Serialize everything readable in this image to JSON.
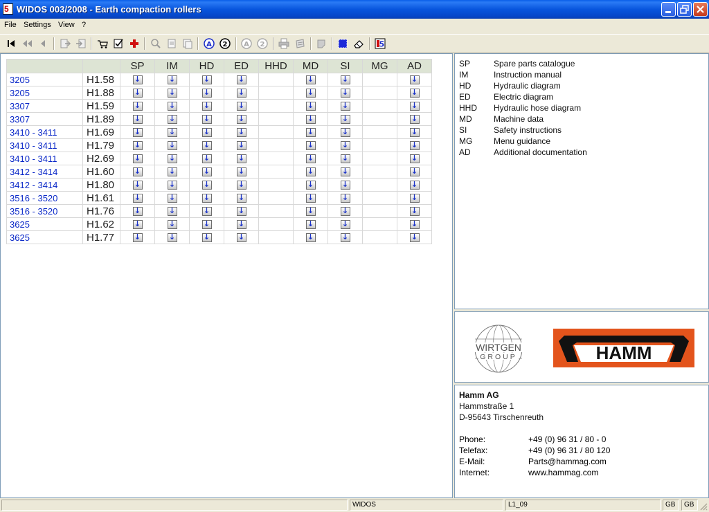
{
  "window": {
    "title": "WIDOS 003/2008 - Earth compaction rollers",
    "icon_name": "widos-app-icon"
  },
  "menu": [
    "File",
    "Settings",
    "View",
    "?"
  ],
  "toolbar": {
    "icons": [
      "first-record-icon",
      "previous-fast-icon",
      "previous-icon",
      "export-icon",
      "import-icon",
      "cart-icon",
      "checklist-icon",
      "add-red-cross-icon",
      "zoom-icon",
      "page-icon",
      "page-copy-icon",
      "marker-a-icon",
      "marker-2-icon",
      "marker-a-disabled-icon",
      "marker-2-disabled-icon",
      "print-icon",
      "print-preview-icon",
      "note-icon",
      "select-grid-icon",
      "eraser-icon",
      "widos-logo-icon"
    ]
  },
  "table": {
    "columns": [
      "",
      "",
      "SP",
      "IM",
      "HD",
      "ED",
      "HHD",
      "MD",
      "SI",
      "MG",
      "AD"
    ],
    "doc_columns": [
      "SP",
      "IM",
      "HD",
      "ED",
      "HHD",
      "MD",
      "SI",
      "MG",
      "AD"
    ],
    "available": [
      "SP",
      "IM",
      "HD",
      "ED",
      "MD",
      "SI",
      "AD"
    ],
    "rows": [
      {
        "model": "3205",
        "version": "H1.58"
      },
      {
        "model": "3205",
        "version": "H1.88"
      },
      {
        "model": "3307",
        "version": "H1.59"
      },
      {
        "model": "3307",
        "version": "H1.89"
      },
      {
        "model": "3410 - 3411",
        "version": "H1.69"
      },
      {
        "model": "3410 - 3411",
        "version": "H1.79"
      },
      {
        "model": "3410 - 3411",
        "version": "H2.69"
      },
      {
        "model": "3412 - 3414",
        "version": "H1.60"
      },
      {
        "model": "3412 - 3414",
        "version": "H1.80"
      },
      {
        "model": "3516 - 3520",
        "version": "H1.61"
      },
      {
        "model": "3516 - 3520",
        "version": "H1.76"
      },
      {
        "model": "3625",
        "version": "H1.62"
      },
      {
        "model": "3625",
        "version": "H1.77"
      }
    ],
    "download_icon": "download-arrow-icon"
  },
  "legend": [
    {
      "abbr": "SP",
      "desc": "Spare parts catalogue"
    },
    {
      "abbr": "IM",
      "desc": "Instruction manual"
    },
    {
      "abbr": "HD",
      "desc": "Hydraulic diagram"
    },
    {
      "abbr": "ED",
      "desc": "Electric diagram"
    },
    {
      "abbr": "HHD",
      "desc": "Hydraulic hose diagram"
    },
    {
      "abbr": "MD",
      "desc": "Machine data"
    },
    {
      "abbr": "SI",
      "desc": "Safety instructions"
    },
    {
      "abbr": "MG",
      "desc": "Menu guidance"
    },
    {
      "abbr": "AD",
      "desc": "Additional documentation"
    }
  ],
  "logos": {
    "wirtgen": {
      "line1": "WIRTGEN",
      "line2": "GROUP"
    },
    "hamm": {
      "text": "HAMM",
      "background": "#e3541c"
    }
  },
  "address": {
    "company": "Hamm AG",
    "street": "Hammstraße 1",
    "city": "D-95643 Tirschenreuth",
    "contacts": [
      {
        "label": "Phone:",
        "value": "+49 (0) 96 31 / 80 - 0"
      },
      {
        "label": "Telefax:",
        "value": "+49 (0) 96 31 / 80 120"
      },
      {
        "label": "E-Mail:",
        "value": "Parts@hammag.com"
      },
      {
        "label": "Internet:",
        "value": "www.hammag.com"
      }
    ]
  },
  "status": {
    "app": "WIDOS",
    "code": "L1_09",
    "lang1": "GB",
    "lang2": "GB"
  },
  "colors": {
    "link": "#0a28c8",
    "header_bg": "#dde4d4",
    "hamm_orange": "#e3541c",
    "titlebar": "#0855dd"
  }
}
